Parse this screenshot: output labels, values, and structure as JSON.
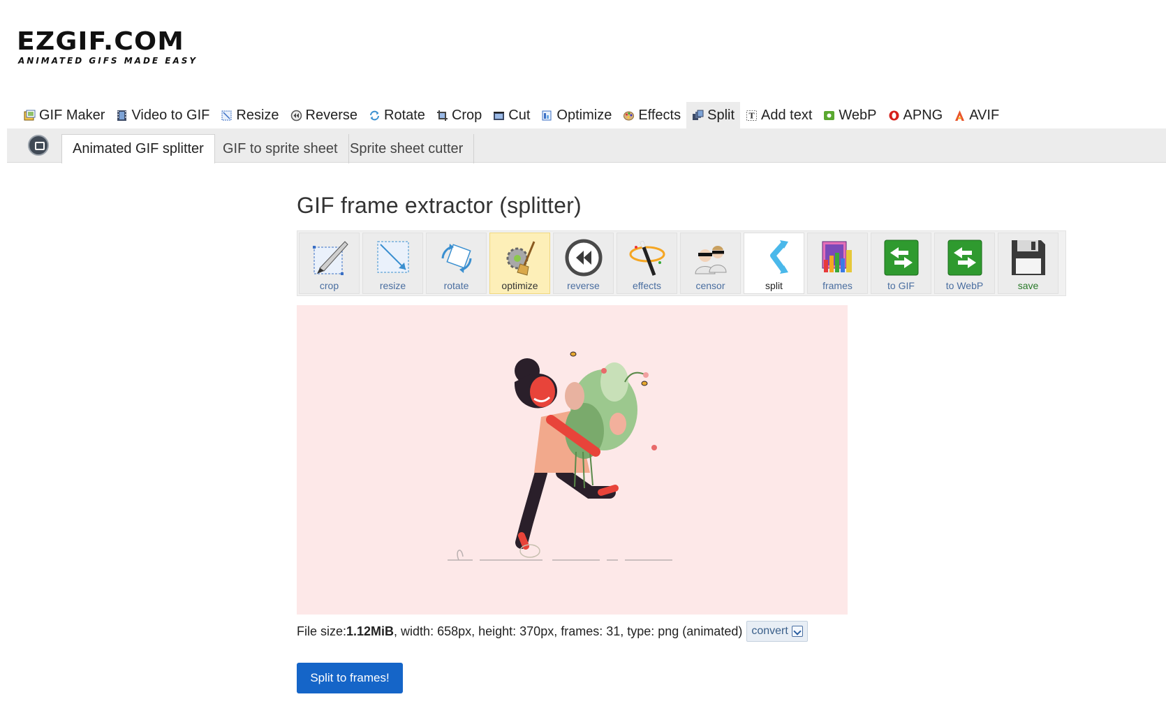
{
  "logo": {
    "main": "EZGIF.COM",
    "tagline": "ANIMATED GIFS MADE EASY"
  },
  "main_nav": [
    {
      "label": "GIF Maker",
      "icon": "gif-maker-icon",
      "active": false
    },
    {
      "label": "Video to GIF",
      "icon": "film-icon",
      "active": false
    },
    {
      "label": "Resize",
      "icon": "resize-icon",
      "active": false
    },
    {
      "label": "Reverse",
      "icon": "reverse-icon",
      "active": false
    },
    {
      "label": "Rotate",
      "icon": "rotate-icon",
      "active": false
    },
    {
      "label": "Crop",
      "icon": "crop-icon",
      "active": false
    },
    {
      "label": "Cut",
      "icon": "cut-icon",
      "active": false
    },
    {
      "label": "Optimize",
      "icon": "optimize-icon",
      "active": false
    },
    {
      "label": "Effects",
      "icon": "effects-icon",
      "active": false
    },
    {
      "label": "Split",
      "icon": "split-icon",
      "active": true
    },
    {
      "label": "Add text",
      "icon": "add-text-icon",
      "active": false
    },
    {
      "label": "WebP",
      "icon": "webp-icon",
      "active": false
    },
    {
      "label": "APNG",
      "icon": "apng-icon",
      "active": false
    },
    {
      "label": "AVIF",
      "icon": "avif-icon",
      "active": false
    }
  ],
  "sub_nav": {
    "home_icon": "home-window-icon",
    "tabs": [
      {
        "label": "Animated GIF splitter",
        "active": true
      },
      {
        "label": "GIF to sprite sheet",
        "active": false
      },
      {
        "label": "Sprite sheet cutter",
        "active": false
      }
    ]
  },
  "page": {
    "title": "GIF frame extractor (splitter)"
  },
  "toolbar": [
    {
      "label": "crop",
      "icon": "crop-tool-icon"
    },
    {
      "label": "resize",
      "icon": "resize-tool-icon"
    },
    {
      "label": "rotate",
      "icon": "rotate-tool-icon"
    },
    {
      "label": "optimize",
      "icon": "optimize-tool-icon",
      "state": "highlight"
    },
    {
      "label": "reverse",
      "icon": "reverse-tool-icon"
    },
    {
      "label": "effects",
      "icon": "effects-tool-icon"
    },
    {
      "label": "censor",
      "icon": "censor-tool-icon"
    },
    {
      "label": "split",
      "icon": "split-tool-icon",
      "state": "current"
    },
    {
      "label": "frames",
      "icon": "frames-tool-icon"
    },
    {
      "label": "to GIF",
      "icon": "to-gif-tool-icon"
    },
    {
      "label": "to WebP",
      "icon": "to-webp-tool-icon"
    },
    {
      "label": "save",
      "icon": "save-tool-icon"
    }
  ],
  "file_info": {
    "size_label": "File size: ",
    "size_value": "1.12MiB",
    "details": ", width: 658px, height: 370px, frames: 31, type: png (animated)",
    "convert_label": "convert"
  },
  "actions": {
    "split_label": "Split to frames!"
  },
  "colors": {
    "preview_bg": "#fde8e8",
    "primary_button": "#1565c8",
    "highlight_tool": "#fdefb8"
  }
}
